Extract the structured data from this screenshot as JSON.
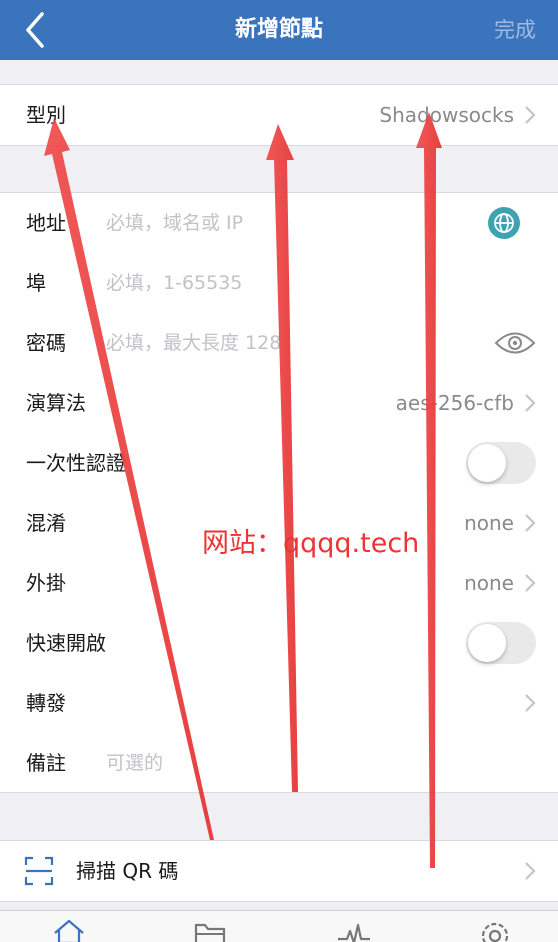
{
  "navbar": {
    "title": "新增節點",
    "done_label": "完成",
    "bg_color": "#3a74bd"
  },
  "type_row": {
    "label": "型別",
    "value": "Shadowsocks"
  },
  "fields": {
    "address": {
      "label": "地址",
      "placeholder": "必填，域名或 IP"
    },
    "port": {
      "label": "埠",
      "placeholder": "必填，1-65535"
    },
    "password": {
      "label": "密碼",
      "placeholder": "必填，最大長度 128"
    },
    "cipher": {
      "label": "演算法",
      "value": "aes-256-cfb"
    },
    "ota": {
      "label": "一次性認證",
      "enabled": false
    },
    "obfs": {
      "label": "混淆",
      "value": "none"
    },
    "plugin": {
      "label": "外掛",
      "value": "none"
    },
    "fast_open": {
      "label": "快速開啟",
      "enabled": false
    },
    "forward": {
      "label": "轉發"
    },
    "remark": {
      "label": "備註",
      "placeholder": "可選的"
    }
  },
  "scan_row": {
    "label": "掃描 QR 碼"
  },
  "tabbar": {
    "icons": [
      "home-icon",
      "folder-icon",
      "activity-icon",
      "settings-icon"
    ]
  },
  "watermark": {
    "text": "网站：qqqq.tech",
    "color": "#ee3333"
  },
  "accent_color": "#3ea3b0"
}
